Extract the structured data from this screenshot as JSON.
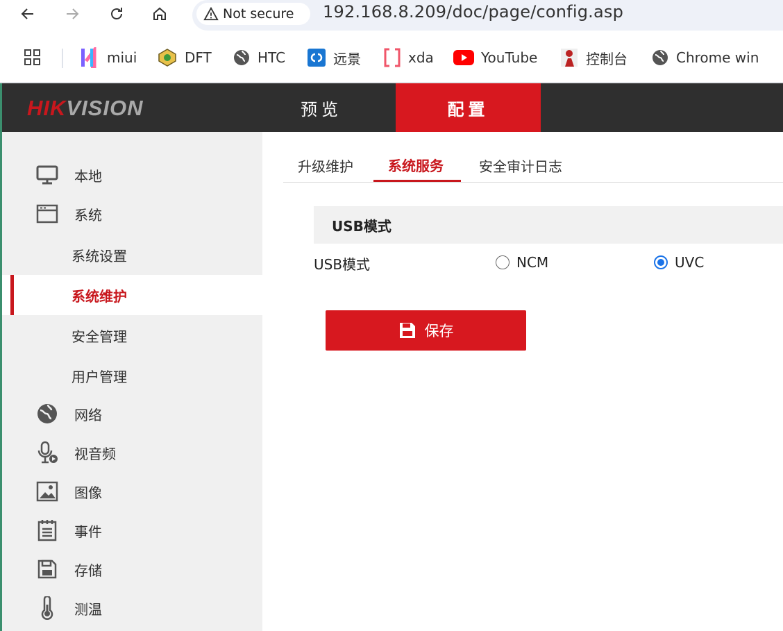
{
  "browser": {
    "security_label": "Not secure",
    "url": "192.168.8.209/doc/page/config.asp",
    "bookmarks": [
      {
        "label": "miui",
        "icon": "miui-icon"
      },
      {
        "label": "DFT",
        "icon": "dft-icon"
      },
      {
        "label": "HTC",
        "icon": "globe-icon"
      },
      {
        "label": "远景",
        "icon": "pcbeta-icon"
      },
      {
        "label": "xda",
        "icon": "xda-icon"
      },
      {
        "label": "YouTube",
        "icon": "youtube-icon"
      },
      {
        "label": "控制台",
        "icon": "console-icon"
      },
      {
        "label": "Chrome win",
        "icon": "globe-icon"
      }
    ]
  },
  "header": {
    "logo_hik": "HIK",
    "logo_vision": "VISION",
    "tabs": [
      {
        "label": "预览",
        "active": false
      },
      {
        "label": "配置",
        "active": true
      }
    ]
  },
  "sidebar": {
    "items": [
      {
        "label": "本地",
        "icon": "monitor-icon"
      },
      {
        "label": "系统",
        "icon": "window-icon"
      },
      {
        "label": "系统设置",
        "sub": true
      },
      {
        "label": "系统维护",
        "sub": true,
        "active": true
      },
      {
        "label": "安全管理",
        "sub": true
      },
      {
        "label": "用户管理",
        "sub": true
      },
      {
        "label": "网络",
        "icon": "globe-icon"
      },
      {
        "label": "视音频",
        "icon": "microphone-icon"
      },
      {
        "label": "图像",
        "icon": "image-icon"
      },
      {
        "label": "事件",
        "icon": "calendar-list-icon"
      },
      {
        "label": "存储",
        "icon": "floppy-icon"
      },
      {
        "label": "测温",
        "icon": "thermometer-icon"
      }
    ]
  },
  "content": {
    "tabs": [
      {
        "label": "升级维护",
        "active": false
      },
      {
        "label": "系统服务",
        "active": true
      },
      {
        "label": "安全审计日志",
        "active": false
      }
    ],
    "section_title": "USB模式",
    "field_label": "USB模式",
    "options": [
      {
        "label": "NCM",
        "checked": false
      },
      {
        "label": "UVC",
        "checked": true
      }
    ],
    "save_label": "保存"
  },
  "colors": {
    "brand_red": "#d7181f",
    "header_dark": "#2f2f2f",
    "sidebar_bg": "#f0f0f0",
    "radio_blue": "#1a73e8"
  }
}
